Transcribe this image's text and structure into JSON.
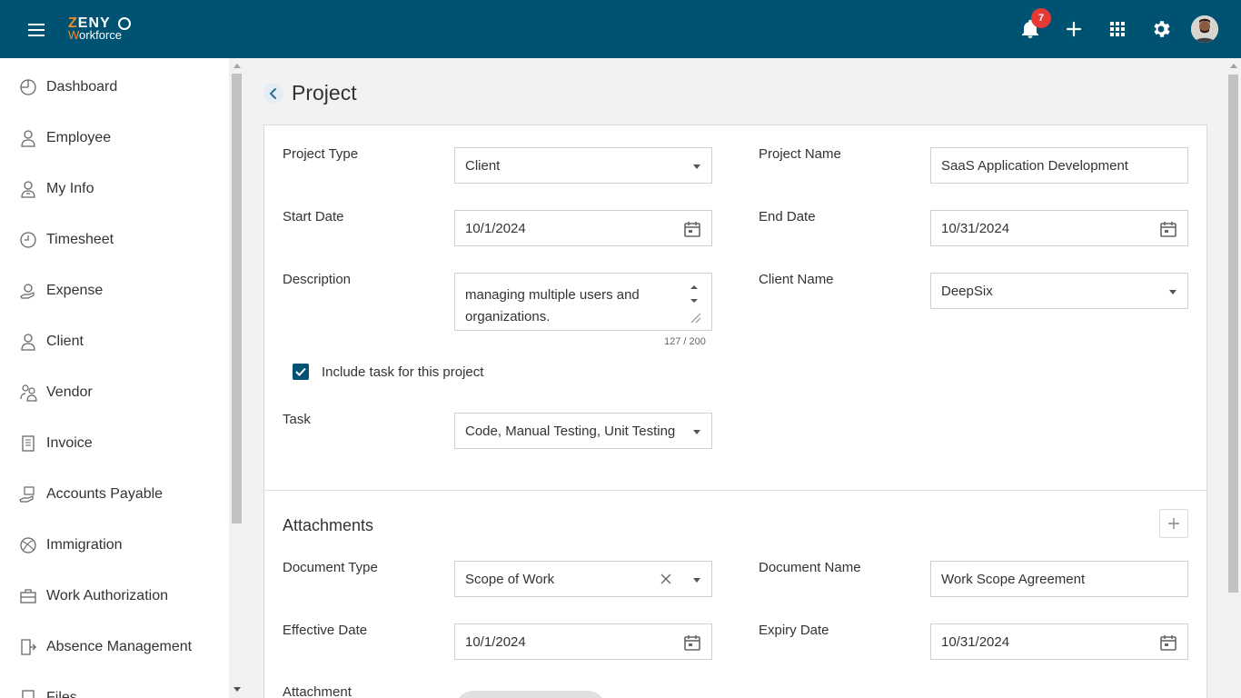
{
  "app": {
    "logo_top": "ZENY",
    "logo_sub": "Workforce",
    "notification_count": "7",
    "brand_color": "#005273",
    "accent_color": "#f28c28"
  },
  "header_icons": [
    "menu-icon",
    "bell-icon",
    "plus-icon",
    "grid-icon",
    "gear-icon",
    "avatar"
  ],
  "sidebar": {
    "items": [
      {
        "label": "Dashboard",
        "icon": "dashboard-icon"
      },
      {
        "label": "Employee",
        "icon": "employee-icon"
      },
      {
        "label": "My Info",
        "icon": "my-info-icon"
      },
      {
        "label": "Timesheet",
        "icon": "clock-icon"
      },
      {
        "label": "Expense",
        "icon": "expense-icon"
      },
      {
        "label": "Client",
        "icon": "user-icon"
      },
      {
        "label": "Vendor",
        "icon": "vendor-icon"
      },
      {
        "label": "Invoice",
        "icon": "invoice-icon"
      },
      {
        "label": "Accounts Payable",
        "icon": "payable-icon"
      },
      {
        "label": "Immigration",
        "icon": "globe-icon"
      },
      {
        "label": "Work Authorization",
        "icon": "briefcase-icon"
      },
      {
        "label": "Absence Management",
        "icon": "exit-icon"
      },
      {
        "label": "Files",
        "icon": "files-icon"
      }
    ]
  },
  "page": {
    "title": "Project"
  },
  "form": {
    "project_type": {
      "label": "Project Type",
      "value": "Client"
    },
    "project_name": {
      "label": "Project Name",
      "value": "SaaS Application Development"
    },
    "start_date": {
      "label": "Start Date",
      "value": "10/1/2024"
    },
    "end_date": {
      "label": "End Date",
      "value": "10/31/2024"
    },
    "description": {
      "label": "Description",
      "value": "managing multiple users and organizations.",
      "counter": "127 / 200"
    },
    "client_name": {
      "label": "Client Name",
      "value": "DeepSix"
    },
    "include_task": {
      "label": "Include task for this project",
      "checked": true
    },
    "task": {
      "label": "Task",
      "value": "Code, Manual Testing, Unit Testing"
    }
  },
  "attachments": {
    "title": "Attachments",
    "document_type": {
      "label": "Document Type",
      "value": "Scope of Work"
    },
    "document_name": {
      "label": "Document Name",
      "value": "Work Scope Agreement"
    },
    "effective_date": {
      "label": "Effective Date",
      "value": "10/1/2024"
    },
    "expiry_date": {
      "label": "Expiry Date",
      "value": "10/31/2024"
    },
    "attachment": {
      "label": "Attachment"
    }
  }
}
